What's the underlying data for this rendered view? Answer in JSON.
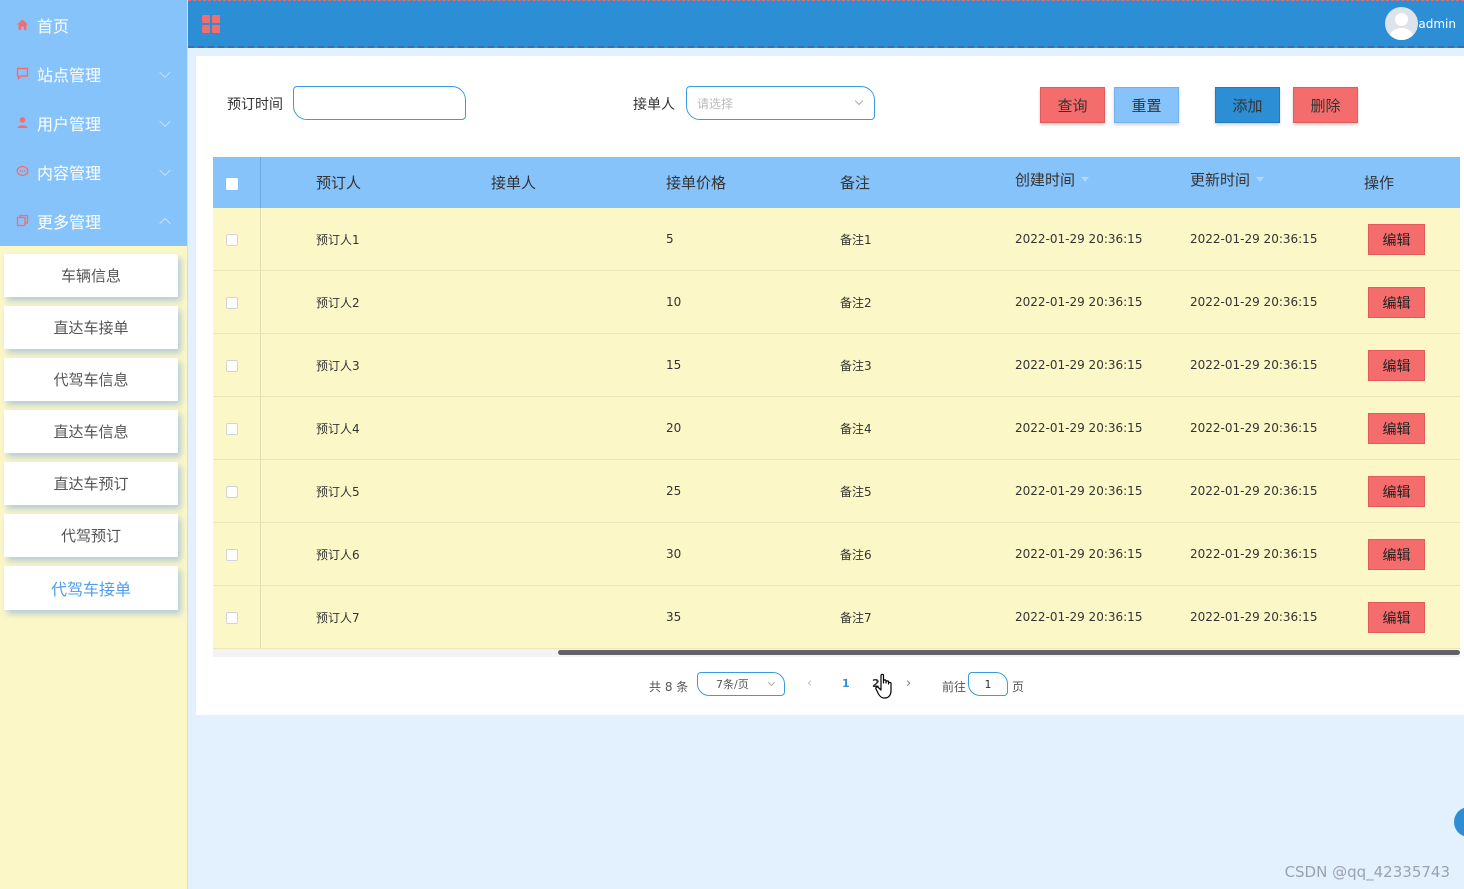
{
  "sidebar": {
    "menu": [
      {
        "label": "首页",
        "icon": "home-icon"
      },
      {
        "label": "站点管理",
        "icon": "chat-icon"
      },
      {
        "label": "用户管理",
        "icon": "user-icon"
      },
      {
        "label": "内容管理",
        "icon": "message-icon"
      },
      {
        "label": "更多管理",
        "icon": "copy-icon"
      }
    ],
    "submenu": [
      "车辆信息",
      "直达车接单",
      "代驾车信息",
      "直达车信息",
      "直达车预订",
      "代驾预订",
      "代驾车接单"
    ],
    "active_submenu": "代驾车接单"
  },
  "header": {
    "username": "admin"
  },
  "search": {
    "time_label": "预订时间",
    "time_value": "",
    "taker_label": "接单人",
    "taker_placeholder": "请选择",
    "query_button": "查询",
    "reset_button": "重置",
    "add_button": "添加",
    "delete_button": "删除"
  },
  "table": {
    "columns": [
      "预订人",
      "接单人",
      "接单价格",
      "备注",
      "创建时间",
      "更新时间",
      "操作"
    ],
    "rows": [
      {
        "booker": "预订人1",
        "taker": "",
        "price": "5",
        "note": "备注1",
        "created": "2022-01-29 20:36:15",
        "updated": "2022-01-29 20:36:15"
      },
      {
        "booker": "预订人2",
        "taker": "",
        "price": "10",
        "note": "备注2",
        "created": "2022-01-29 20:36:15",
        "updated": "2022-01-29 20:36:15"
      },
      {
        "booker": "预订人3",
        "taker": "",
        "price": "15",
        "note": "备注3",
        "created": "2022-01-29 20:36:15",
        "updated": "2022-01-29 20:36:15"
      },
      {
        "booker": "预订人4",
        "taker": "",
        "price": "20",
        "note": "备注4",
        "created": "2022-01-29 20:36:15",
        "updated": "2022-01-29 20:36:15"
      },
      {
        "booker": "预订人5",
        "taker": "",
        "price": "25",
        "note": "备注5",
        "created": "2022-01-29 20:36:15",
        "updated": "2022-01-29 20:36:15"
      },
      {
        "booker": "预订人6",
        "taker": "",
        "price": "30",
        "note": "备注6",
        "created": "2022-01-29 20:36:15",
        "updated": "2022-01-29 20:36:15"
      },
      {
        "booker": "预订人7",
        "taker": "",
        "price": "35",
        "note": "备注7",
        "created": "2022-01-29 20:36:15",
        "updated": "2022-01-29 20:36:15"
      }
    ],
    "edit_label": "编辑"
  },
  "pagination": {
    "total": "共 8 条",
    "page_size": "7条/页",
    "prev": "‹",
    "pages": [
      "1",
      "2"
    ],
    "current_page": "1",
    "next": "›",
    "goto_label": "前往",
    "goto_value": "1",
    "goto_suffix": "页"
  },
  "watermark": "CSDN @qq_42335743",
  "colors": {
    "sidebar_top": "#87c3fb",
    "sidebar_bg": "#fcf7c7",
    "header": "#2c8fd6",
    "accent_red": "#f56c6c",
    "table_row": "#fcf7c7",
    "page_bg": "#e3f0fd"
  }
}
